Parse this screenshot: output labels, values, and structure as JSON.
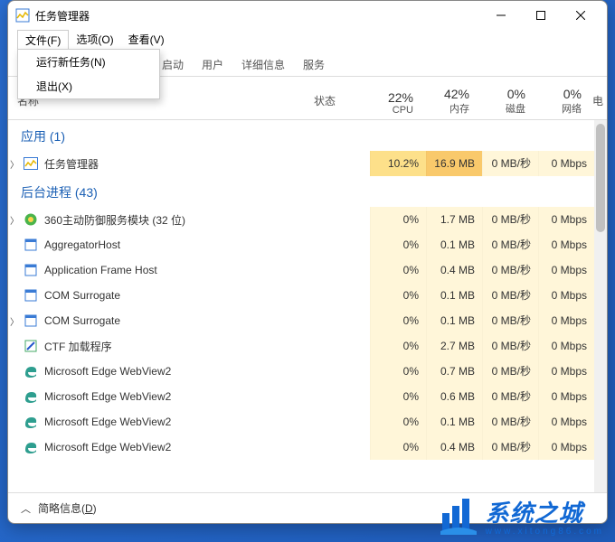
{
  "window": {
    "title": "任务管理器"
  },
  "menubar": {
    "file": "文件(F)",
    "options": "选项(O)",
    "view": "查看(V)"
  },
  "dropdown": {
    "run": "运行新任务(N)",
    "exit": "退出(X)"
  },
  "tabs": {
    "startup": "启动",
    "users": "用户",
    "details": "详细信息",
    "services": "服务"
  },
  "columns": {
    "name": "名称",
    "status": "状态",
    "cpu_pct": "22%",
    "cpu_lbl": "CPU",
    "mem_pct": "42%",
    "mem_lbl": "内存",
    "disk_pct": "0%",
    "disk_lbl": "磁盘",
    "net_pct": "0%",
    "net_lbl": "网络",
    "power": "电"
  },
  "sections": {
    "apps": "应用 (1)",
    "bg": "后台进程 (43)"
  },
  "apps": [
    {
      "name": "任务管理器",
      "cpu": "10.2%",
      "mem": "16.9 MB",
      "disk": "0 MB/秒",
      "net": "0 Mbps",
      "expand": true,
      "icon": "taskmgr"
    }
  ],
  "bg": [
    {
      "name": "360主动防御服务模块 (32 位)",
      "cpu": "0%",
      "mem": "1.7 MB",
      "disk": "0 MB/秒",
      "net": "0 Mbps",
      "expand": true,
      "icon": "360"
    },
    {
      "name": "AggregatorHost",
      "cpu": "0%",
      "mem": "0.1 MB",
      "disk": "0 MB/秒",
      "net": "0 Mbps",
      "icon": "generic"
    },
    {
      "name": "Application Frame Host",
      "cpu": "0%",
      "mem": "0.4 MB",
      "disk": "0 MB/秒",
      "net": "0 Mbps",
      "icon": "generic"
    },
    {
      "name": "COM Surrogate",
      "cpu": "0%",
      "mem": "0.1 MB",
      "disk": "0 MB/秒",
      "net": "0 Mbps",
      "icon": "generic"
    },
    {
      "name": "COM Surrogate",
      "cpu": "0%",
      "mem": "0.1 MB",
      "disk": "0 MB/秒",
      "net": "0 Mbps",
      "expand": true,
      "icon": "generic"
    },
    {
      "name": "CTF 加载程序",
      "cpu": "0%",
      "mem": "2.7 MB",
      "disk": "0 MB/秒",
      "net": "0 Mbps",
      "icon": "ctf"
    },
    {
      "name": "Microsoft Edge WebView2",
      "cpu": "0%",
      "mem": "0.7 MB",
      "disk": "0 MB/秒",
      "net": "0 Mbps",
      "icon": "edge"
    },
    {
      "name": "Microsoft Edge WebView2",
      "cpu": "0%",
      "mem": "0.6 MB",
      "disk": "0 MB/秒",
      "net": "0 Mbps",
      "icon": "edge"
    },
    {
      "name": "Microsoft Edge WebView2",
      "cpu": "0%",
      "mem": "0.1 MB",
      "disk": "0 MB/秒",
      "net": "0 Mbps",
      "icon": "edge"
    },
    {
      "name": "Microsoft Edge WebView2",
      "cpu": "0%",
      "mem": "0.4 MB",
      "disk": "0 MB/秒",
      "net": "0 Mbps",
      "icon": "edge"
    }
  ],
  "footer": {
    "label_pre": "简略信息(",
    "label_key": "D",
    "label_post": ")"
  },
  "watermark": {
    "name": "系统之城",
    "url": "www.xitong86.com"
  }
}
